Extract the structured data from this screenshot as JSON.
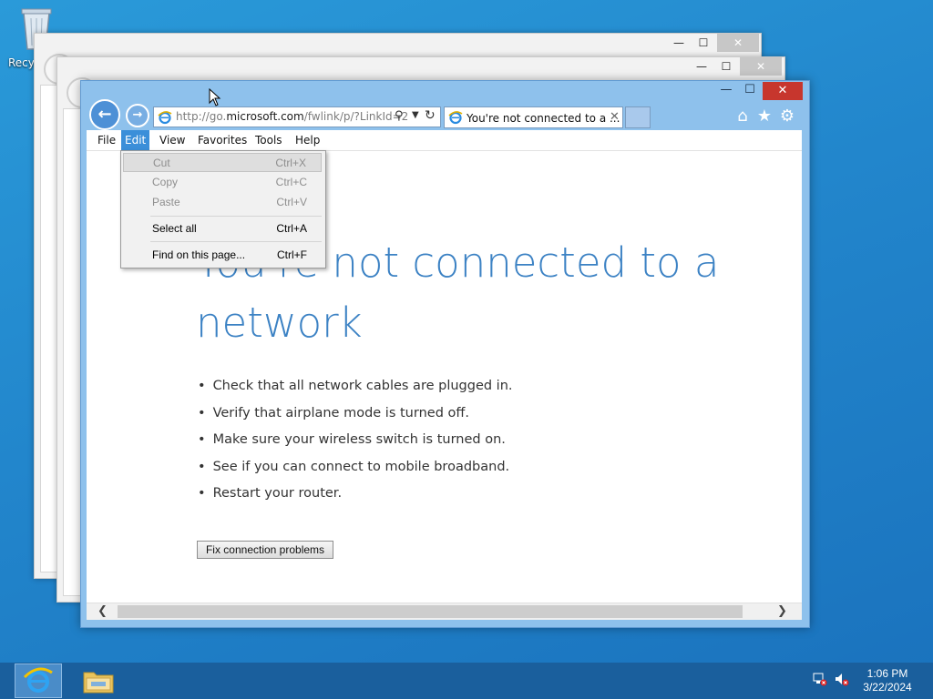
{
  "desktop": {
    "recycle_label": "Recyc"
  },
  "background_windows": [
    {
      "minimize": "—",
      "maximize": "☐",
      "close": "✕"
    },
    {
      "minimize": "—",
      "maximize": "☐",
      "close": "✕"
    }
  ],
  "browser": {
    "window": {
      "minimize": "—",
      "maximize": "☐",
      "close": "✕"
    },
    "address_prefix": "http://go.",
    "address_domain": "microsoft.com",
    "address_suffix": "/fwlink/p/?LinkId=2",
    "tab_title": "You're not connected to a ...",
    "tab_close": "✕",
    "toolbar_icons": [
      "home-icon",
      "favorites-star-icon",
      "tools-gear-icon"
    ],
    "menu": [
      "File",
      "Edit",
      "View",
      "Favorites",
      "Tools",
      "Help"
    ],
    "active_menu": "Edit"
  },
  "edit_menu": {
    "items": [
      {
        "label": "Cut",
        "shortcut": "Ctrl+X",
        "enabled": false
      },
      {
        "label": "Copy",
        "shortcut": "Ctrl+C",
        "enabled": false
      },
      {
        "label": "Paste",
        "shortcut": "Ctrl+V",
        "enabled": false
      },
      {
        "label": "Select all",
        "shortcut": "Ctrl+A",
        "enabled": true
      },
      {
        "label": "Find on this page...",
        "shortcut": "Ctrl+F",
        "enabled": true
      }
    ]
  },
  "page": {
    "headline_line1": "You're not connected to a",
    "headline_line2": "network",
    "bullets": [
      "Check that all network cables are plugged in.",
      "Verify that airplane mode is turned off.",
      "Make sure your wireless switch is turned on.",
      "See if you can connect to mobile broadband.",
      "Restart your router."
    ],
    "fix_button": "Fix connection problems"
  },
  "taskbar": {
    "time": "1:06 PM",
    "date": "3/22/2024",
    "tray_icons": [
      "network-error-icon",
      "volume-muted-icon"
    ]
  },
  "colors": {
    "accent": "#3b8fd9",
    "headline": "#3c82c4",
    "close": "#c7362d",
    "taskbar": "#1a5f9d"
  }
}
